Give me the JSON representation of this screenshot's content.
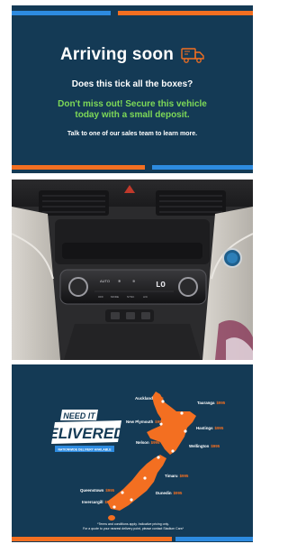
{
  "arriving": {
    "title": "Arriving soon",
    "question": "Does this tick all the boxes?",
    "promo_line1": "Don't miss out! Secure this vehicle",
    "promo_line2": "today with a small deposit.",
    "sales": "Talk to one of our sales team to learn more."
  },
  "delivery": {
    "need_it": "NEED IT",
    "delivered": "DELIVERED?",
    "ribbon": "NATIONWIDE DELIVERY AVAILABLE",
    "cities": [
      {
        "name": "Auckland",
        "price": "$995"
      },
      {
        "name": "Tauranga",
        "price": "$995"
      },
      {
        "name": "New Plymouth",
        "price": "$995"
      },
      {
        "name": "Hastings",
        "price": "$995"
      },
      {
        "name": "Nelson",
        "price": "$995"
      },
      {
        "name": "Wellington",
        "price": "$995"
      },
      {
        "name": "Timaru",
        "price": "$995"
      },
      {
        "name": "Queenstown",
        "price": "$995"
      },
      {
        "name": "Dunedin",
        "price": "$995"
      },
      {
        "name": "Invercargill",
        "price": "$995"
      }
    ],
    "terms_line1": "*Terms and conditions apply. Indicative pricing only.",
    "terms_line2": "For a quote to your nearest delivery point, please contact Stadium Cars*"
  },
  "dashboard": {
    "display": "LO"
  },
  "colors": {
    "navy": "#143a55",
    "orange": "#f36f21",
    "blue": "#2d8be0",
    "green": "#7ed957"
  }
}
